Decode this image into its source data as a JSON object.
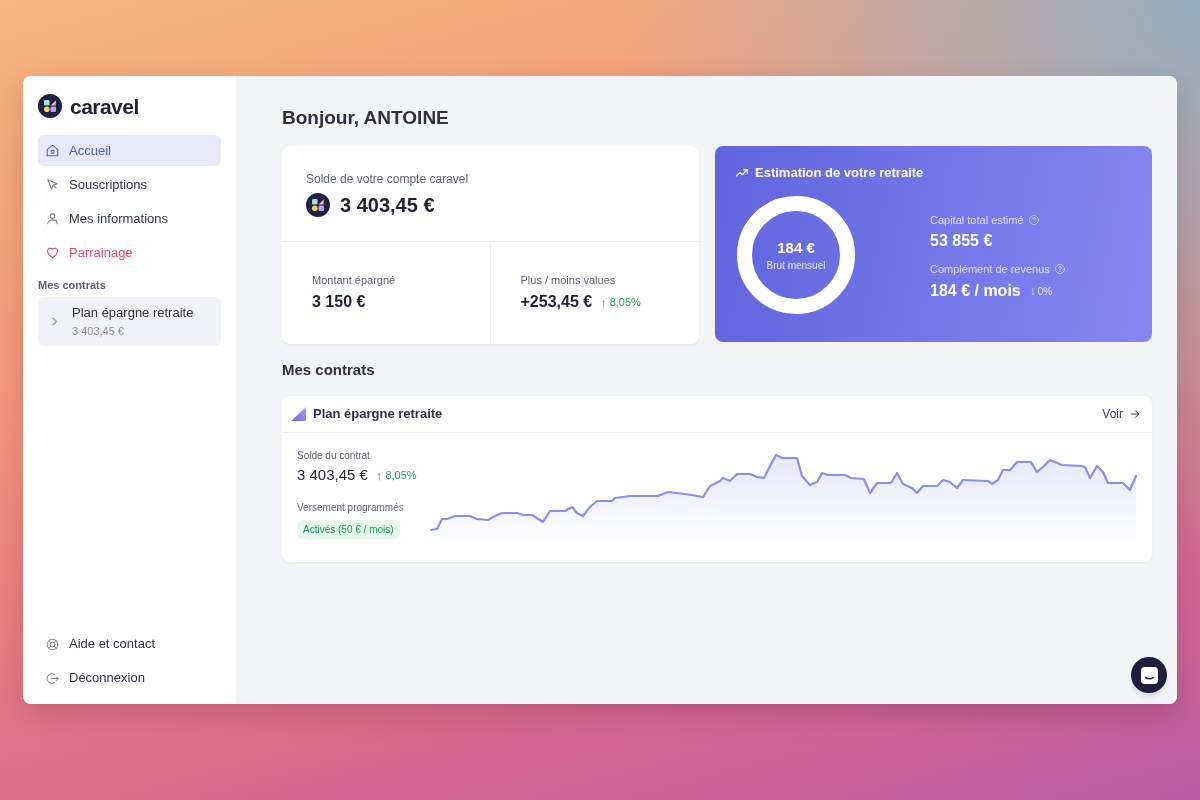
{
  "sidebar": {
    "logo": "caravel",
    "nav": [
      {
        "label": "Accueil",
        "kind": "default",
        "selected": true
      },
      {
        "label": "Souscriptions",
        "kind": "default",
        "selected": false
      },
      {
        "label": "Mes informations",
        "kind": "default",
        "selected": false
      },
      {
        "label": "Parrainage",
        "kind": "accent",
        "selected": false
      }
    ],
    "contracts_title": "Mes contrats",
    "contracts": [
      {
        "name": "Plan épargne retraite",
        "amount": "3 403,45 €",
        "expanded": false
      }
    ],
    "footer": [
      {
        "label": "Aide et contact"
      },
      {
        "label": "Déconnexion"
      }
    ]
  },
  "main": {
    "greeting": "Bonjour, ANTOINE",
    "balance_card": {
      "label": "Solde de votre compte caravel",
      "amount": "3 403,45 €",
      "stats": [
        {
          "label": "Montant épargné",
          "value": "3 150 €"
        },
        {
          "label": "Plus / moins values",
          "value": "+253,45 €",
          "arrow": "↑",
          "change": "8,05%"
        }
      ]
    },
    "retirement_card": {
      "title": "Estimation de votre retraite",
      "ring": {
        "value": "184 €",
        "caption": "Brut mensuel"
      },
      "figures": [
        {
          "label": "Capital total estimé",
          "value": "53 855 €"
        },
        {
          "label": "Complément de revenus",
          "value": "184 € / mois",
          "arrow": "↓",
          "change": "0%"
        }
      ]
    },
    "contracts_title": "Mes contrats",
    "contracts": [
      {
        "name": "Plan épargne retraite",
        "link": "Voir",
        "balance_label": "Solde du contrat",
        "balance": "3 403,45 €",
        "arrow": "↑",
        "change": "8,05%",
        "payments_label": "Versement programmés",
        "payments_badge": "Activés (50 € / mois)"
      }
    ]
  }
}
